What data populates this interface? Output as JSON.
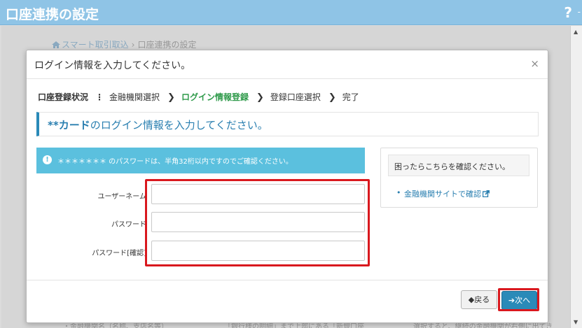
{
  "page": {
    "title": "口座連携の設定",
    "help": "?",
    "help_suffix": "-",
    "breadcrumb": {
      "home": "スマート取引取込",
      "separator": "›",
      "current": "口座連携の設定"
    },
    "bottom_text": "・金融機関名（名称、支店名等）　　　　　　　　　「銀行様の明細」まで上部にある「新規口座　　　　　　　選択すると、継続の金融機関が右側に出てき"
  },
  "modal": {
    "title": "ログイン情報を入力してください。",
    "close": "×",
    "steps": {
      "label": "口座登録状況",
      "colon": "⋮",
      "items": [
        "金融機関選択",
        "ログイン情報登録",
        "登録口座選択",
        "完了"
      ],
      "arrow": "❯",
      "active_index": 1
    },
    "heading": {
      "bold": "**カード",
      "rest": "のログイン情報を入力してください。"
    },
    "info": {
      "icon": "!",
      "text": "＊＊＊＊＊＊＊ のパスワードは、半角32桁以内ですのでご確認ください。"
    },
    "form": {
      "username_label": "ユーザーネーム",
      "username_value": "",
      "password_label": "パスワード",
      "password_value": "",
      "password_confirm_label": "パスワード[確認]",
      "password_confirm_value": ""
    },
    "help_panel": {
      "title": "困ったらこちらを確認ください。",
      "bullet": "•",
      "link": "金融機関サイトで確認"
    },
    "buttons": {
      "back": "◆戻る",
      "next": "➔次へ"
    }
  },
  "colors": {
    "titlebar": "#8fc4e6",
    "accent": "#2a8ab8",
    "info": "#5bc0de",
    "active_step": "#2e9a4a",
    "highlight": "#d9181e"
  }
}
